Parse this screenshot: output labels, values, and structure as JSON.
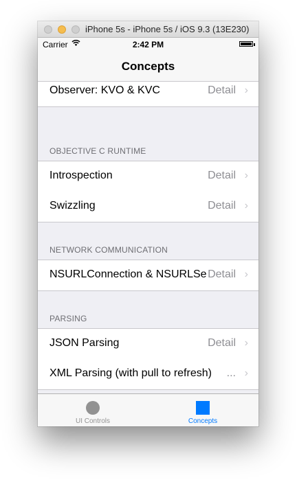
{
  "window": {
    "title": "iPhone 5s - iPhone 5s / iOS 9.3 (13E230)"
  },
  "statusbar": {
    "carrier": "Carrier",
    "time": "2:42 PM"
  },
  "navbar": {
    "title": "Concepts"
  },
  "rows": {
    "observer": {
      "label": "Observer: KVO & KVC",
      "detail": "Detail"
    },
    "introspection": {
      "label": "Introspection",
      "detail": "Detail"
    },
    "swizzling": {
      "label": "Swizzling",
      "detail": "Detail"
    },
    "nsurl": {
      "label": "NSURLConnection & NSURLSession",
      "detail": "Detail"
    },
    "json": {
      "label": "JSON Parsing",
      "detail": "Detail"
    },
    "xml": {
      "label": "XML Parsing (with pull to refresh)",
      "detail": "..."
    }
  },
  "sections": {
    "objc_runtime": "OBJECTIVE C RUNTIME",
    "network": "NETWORK COMMUNICATION",
    "parsing": "PARSING"
  },
  "tabbar": {
    "ui_controls": "UI Controls",
    "concepts": "Concepts"
  },
  "colors": {
    "tint": "#007aff",
    "inactive_tab": "#929292",
    "detail_text": "#8e8e93",
    "group_background": "#efeff4"
  }
}
